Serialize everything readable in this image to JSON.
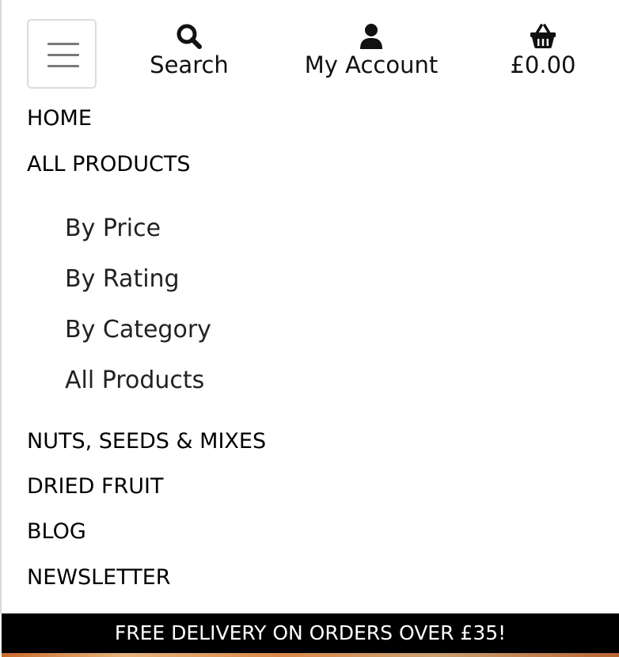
{
  "header": {
    "menu_toggle_icon": "hamburger-menu-icon",
    "search": {
      "icon": "search-icon",
      "label": "Search"
    },
    "account": {
      "icon": "user-icon",
      "label": "My Account"
    },
    "basket": {
      "icon": "basket-icon",
      "total": "£0.00"
    }
  },
  "nav": {
    "items": [
      {
        "label": "HOME"
      },
      {
        "label": "ALL PRODUCTS",
        "submenu": [
          "By Price",
          "By Rating",
          "By Category",
          "All Products"
        ]
      },
      {
        "label": "NUTS, SEEDS & MIXES"
      },
      {
        "label": "DRIED FRUIT"
      },
      {
        "label": "BLOG"
      },
      {
        "label": "NEWSLETTER"
      }
    ]
  },
  "banner": {
    "text": "FREE DELIVERY ON ORDERS OVER £35!"
  },
  "colors": {
    "banner_bg": "#000000",
    "banner_text": "#ffffff",
    "text": "#111111",
    "toggler_border": "#dcdcdc"
  }
}
